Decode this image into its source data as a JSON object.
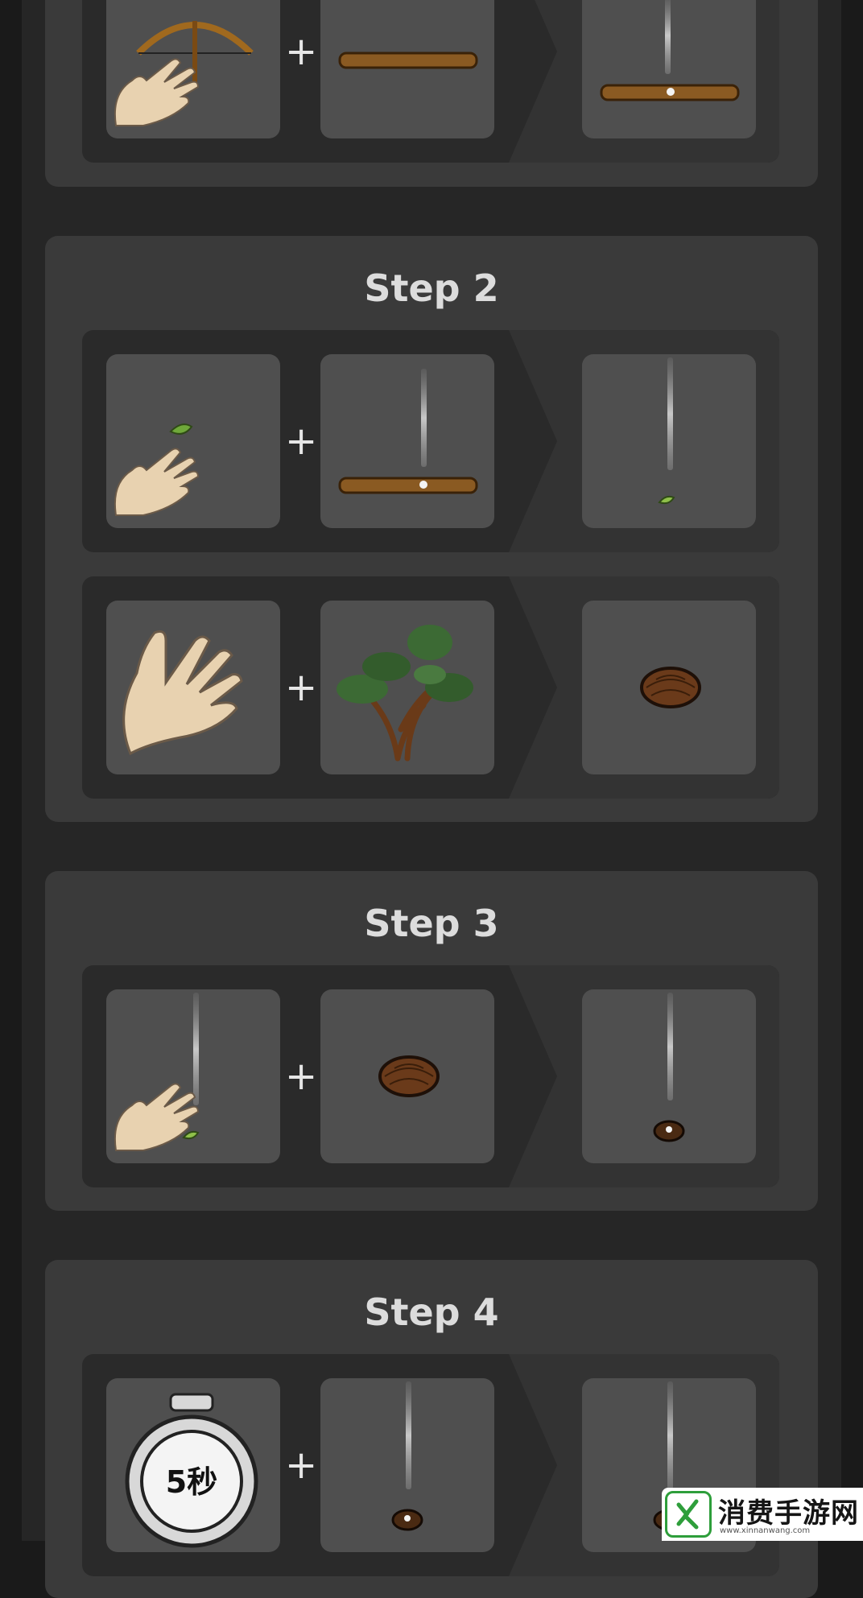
{
  "steps": [
    {
      "title": "",
      "recipes": [
        {
          "input1": "bow-hand",
          "input2": "log",
          "output": "smoking-log"
        }
      ]
    },
    {
      "title": "Step 2",
      "recipes": [
        {
          "input1": "hand-leaf",
          "input2": "smoking-log",
          "output": "smoke-ember"
        },
        {
          "input1": "open-hand",
          "input2": "tree",
          "output": "tinder-bundle"
        }
      ]
    },
    {
      "title": "Step 3",
      "recipes": [
        {
          "input1": "hand-smoke-ember",
          "input2": "tinder-bundle",
          "output": "smoking-tinder"
        }
      ]
    },
    {
      "title": "Step 4",
      "recipes": [
        {
          "input1": "stopwatch",
          "input2": "smoking-tinder",
          "output": "smoking-tinder"
        }
      ]
    }
  ],
  "plus_sign": "+",
  "stopwatch_label": "5秒",
  "watermark": {
    "title": "消费手游网",
    "url": "www.xinnanwang.com"
  },
  "colors": {
    "background": "#1a1a1a",
    "card": "#3a3a3a",
    "row": "#2a2a2a",
    "tile": "#4f4f4f",
    "accent_green": "#2e9e3b"
  }
}
